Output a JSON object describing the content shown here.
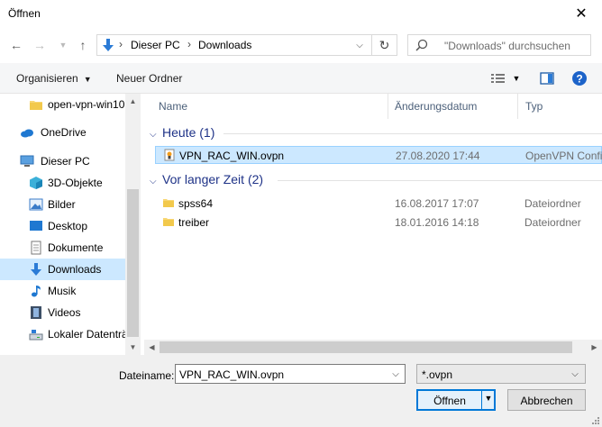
{
  "window": {
    "title": "Öffnen"
  },
  "address": {
    "crumbs": [
      "Dieser PC",
      "Downloads"
    ]
  },
  "search": {
    "placeholder": "\"Downloads\" durchsuchen"
  },
  "toolbar": {
    "organize": "Organisieren",
    "new_folder": "Neuer Ordner"
  },
  "nav": {
    "items": [
      {
        "label": "open-vpn-win10",
        "icon": "folder-icon"
      },
      {
        "label": "OneDrive",
        "icon": "cloud-icon"
      },
      {
        "label": "Dieser PC",
        "icon": "computer-icon"
      },
      {
        "label": "3D-Objekte",
        "icon": "cube-icon"
      },
      {
        "label": "Bilder",
        "icon": "pictures-icon"
      },
      {
        "label": "Desktop",
        "icon": "desktop-icon"
      },
      {
        "label": "Dokumente",
        "icon": "document-icon"
      },
      {
        "label": "Downloads",
        "icon": "download-icon"
      },
      {
        "label": "Musik",
        "icon": "music-icon"
      },
      {
        "label": "Videos",
        "icon": "video-icon"
      },
      {
        "label": "Lokaler Datenträger",
        "icon": "drive-icon"
      }
    ]
  },
  "columns": {
    "name": "Name",
    "date": "Änderungsdatum",
    "type": "Typ"
  },
  "groups": [
    {
      "label": "Heute (1)",
      "files": [
        {
          "name": "VPN_RAC_WIN.ovpn",
          "date": "27.08.2020 17:44",
          "type": "OpenVPN Config",
          "icon": "ovpn-file-icon"
        }
      ]
    },
    {
      "label": "Vor langer Zeit (2)",
      "files": [
        {
          "name": "spss64",
          "date": "16.08.2017 17:07",
          "type": "Dateiordner",
          "icon": "folder-icon"
        },
        {
          "name": "treiber",
          "date": "18.01.2016 14:18",
          "type": "Dateiordner",
          "icon": "folder-icon"
        }
      ]
    }
  ],
  "footer": {
    "filename_label": "Dateiname:",
    "filename_value": "VPN_RAC_WIN.ovpn",
    "filter_value": "*.ovpn",
    "open_label": "Öffnen",
    "cancel_label": "Abbrechen"
  },
  "colors": {
    "selection": "#cce8ff",
    "accent": "#0078d7",
    "group_header": "#1e3287"
  }
}
